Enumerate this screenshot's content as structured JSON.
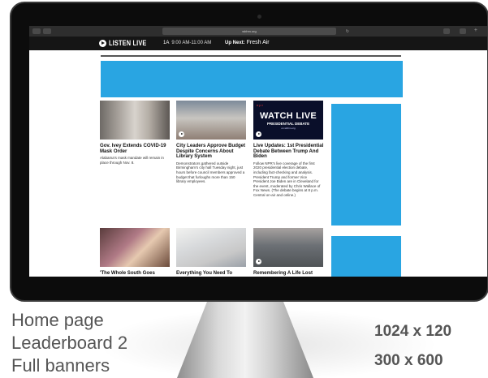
{
  "browser": {
    "url": "wbhm.org",
    "reload_icon": "reload-icon"
  },
  "player_bar": {
    "listen_live": "LISTEN LIVE",
    "show_name": "1A",
    "show_time": "9:00 AM-11:00 AM",
    "up_next_label": "Up Next:",
    "up_next_show": "Fresh Air"
  },
  "articles": [
    {
      "headline": "Gov. Ivey Extends COVID-19 Mask Order",
      "body": "Alabama's mask mandate will remain in place through Nov. 8.",
      "has_play": false
    },
    {
      "headline": "City Leaders Approve Budget Despite Concerns About Library System",
      "body": "Demonstrators gathered outside Birmingham's city hall Tuesday night, just hours before council members approved a budget that furloughs more than 150 library employees.",
      "has_play": true
    },
    {
      "headline": "Live Updates: 1st Presidential Debate Between Trump And Biden",
      "body": "Follow NPR's live coverage of the first 2020 presidential election debate, including fact-checking and analysis. President Trump and former Vice President Joe Biden are in Cleveland for the event, moderated by Chris Wallace of Fox News. (The debate begins at 8 p.m. Central on-air and online.)",
      "has_play": true,
      "thumb_text": {
        "logo": "n p r",
        "big": "WATCH LIVE",
        "small": "PRESIDENTIAL DEBATE",
        "tiny": "on wbhm.org"
      }
    },
    {
      "headline": "'The Whole South Goes",
      "body": "",
      "has_play": false
    },
    {
      "headline": "Everything You Need To",
      "body": "",
      "has_play": false
    },
    {
      "headline": "Remembering A Life Lost",
      "body": "",
      "has_play": true
    }
  ],
  "captions": {
    "left": [
      "Home page",
      "Leaderboard 2",
      "Full banners"
    ],
    "right": [
      "1024 x 120",
      "300 x 600"
    ]
  },
  "colors": {
    "ad_blue": "#29a5e2",
    "player_bar": "#151515"
  }
}
